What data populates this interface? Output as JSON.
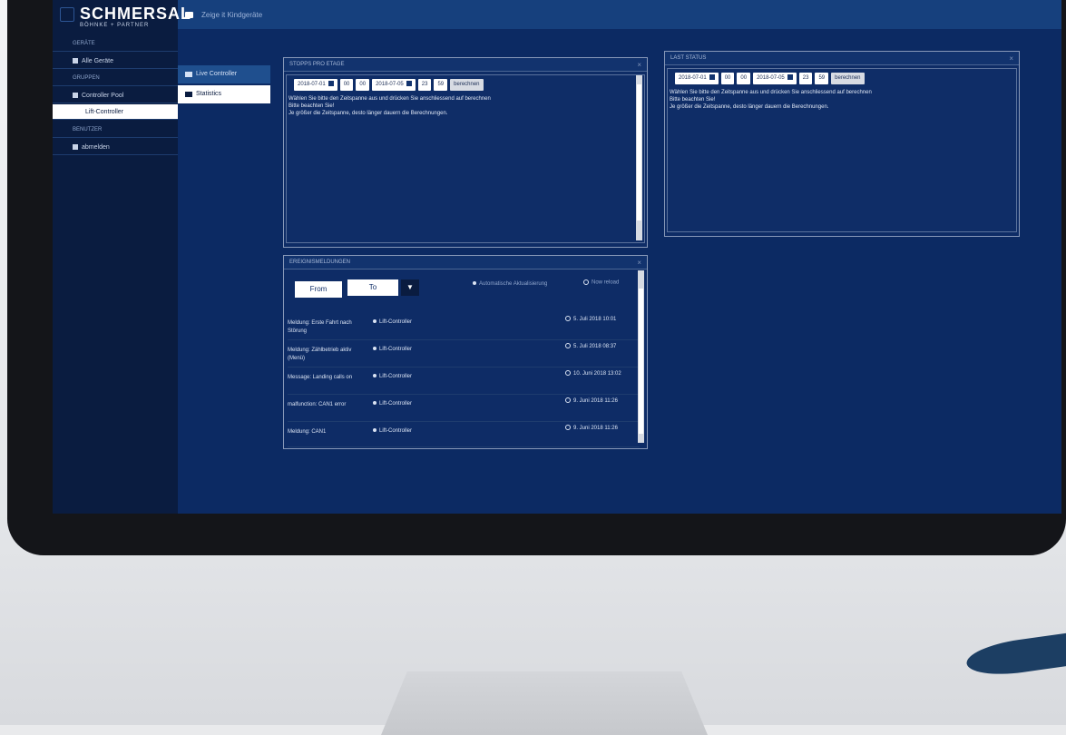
{
  "app": {
    "brand": "SCHMERSAL",
    "brand_sub": "BÖHNKE + PARTNER",
    "breadcrumb": "Zeige it Kindgeräte"
  },
  "sidebar": {
    "items": [
      {
        "label": "GERÄTE",
        "type": "header"
      },
      {
        "label": "Alle Geräte",
        "type": "item"
      },
      {
        "label": "GRUPPEN",
        "type": "header"
      },
      {
        "label": "Controller Pool",
        "type": "item"
      },
      {
        "label": "Lift-Controller",
        "type": "active"
      },
      {
        "label": "BENUTZER",
        "type": "header"
      },
      {
        "label": "abmelden",
        "type": "item"
      }
    ]
  },
  "tabs": [
    {
      "label": "Live Controller"
    },
    {
      "label": "Statistics"
    }
  ],
  "stops_panel": {
    "title": "STOPPS PRO ETAGE",
    "from_date": "2018-07-01",
    "from_hour": "00",
    "from_min": "00",
    "to_date": "2018-07-05",
    "to_hour": "23",
    "to_min": "59",
    "calc_button": "berechnen",
    "message_lines": [
      "Wählen Sie bitte den Zeitspanne aus und drücken Sie anschliessend auf berechnen",
      "Bitte beachten Sie!",
      "Je größer die Zeitspanne, desto länger dauern die Berechnungen."
    ]
  },
  "last_status_panel": {
    "title": "LAST STATUS",
    "from_date": "2018-07-01",
    "from_hour": "00",
    "from_min": "00",
    "to_date": "2018-07-05",
    "to_hour": "23",
    "to_min": "59",
    "calc_button": "berechnen",
    "message_lines": [
      "Wählen Sie bitte den Zeitspanne aus und drücken Sie anschliessend auf berechnen",
      "Bitte beachten Sie!",
      "Je größer die Zeitspanne, desto länger dauern die Berechnungen."
    ]
  },
  "events_panel": {
    "title": "EREIGNISMELDUNGEN",
    "from_button": "From",
    "to_button": "To",
    "filter_icon": "▼",
    "option_auto": "Automatische Aktualisierung",
    "option_now": "Now reload",
    "events": [
      {
        "name": "Meldung: Erste Fahrt nach Störung",
        "device": "Lift-Controller",
        "time": "5. Juli 2018 10:01"
      },
      {
        "name": "Meldung: Zählbetrieb aktiv (Menü)",
        "device": "Lift-Controller",
        "time": "5. Juli 2018 08:37"
      },
      {
        "name": "Message: Landing calls on",
        "device": "Lift-Controller",
        "time": "10. Juni 2018 13:02"
      },
      {
        "name": "malfunction: CAN1 error",
        "device": "Lift-Controller",
        "time": "9. Juni 2018 11:26"
      },
      {
        "name": "Meldung: CAN1",
        "device": "Lift-Controller",
        "time": "9. Juni 2018 11:26"
      }
    ]
  }
}
